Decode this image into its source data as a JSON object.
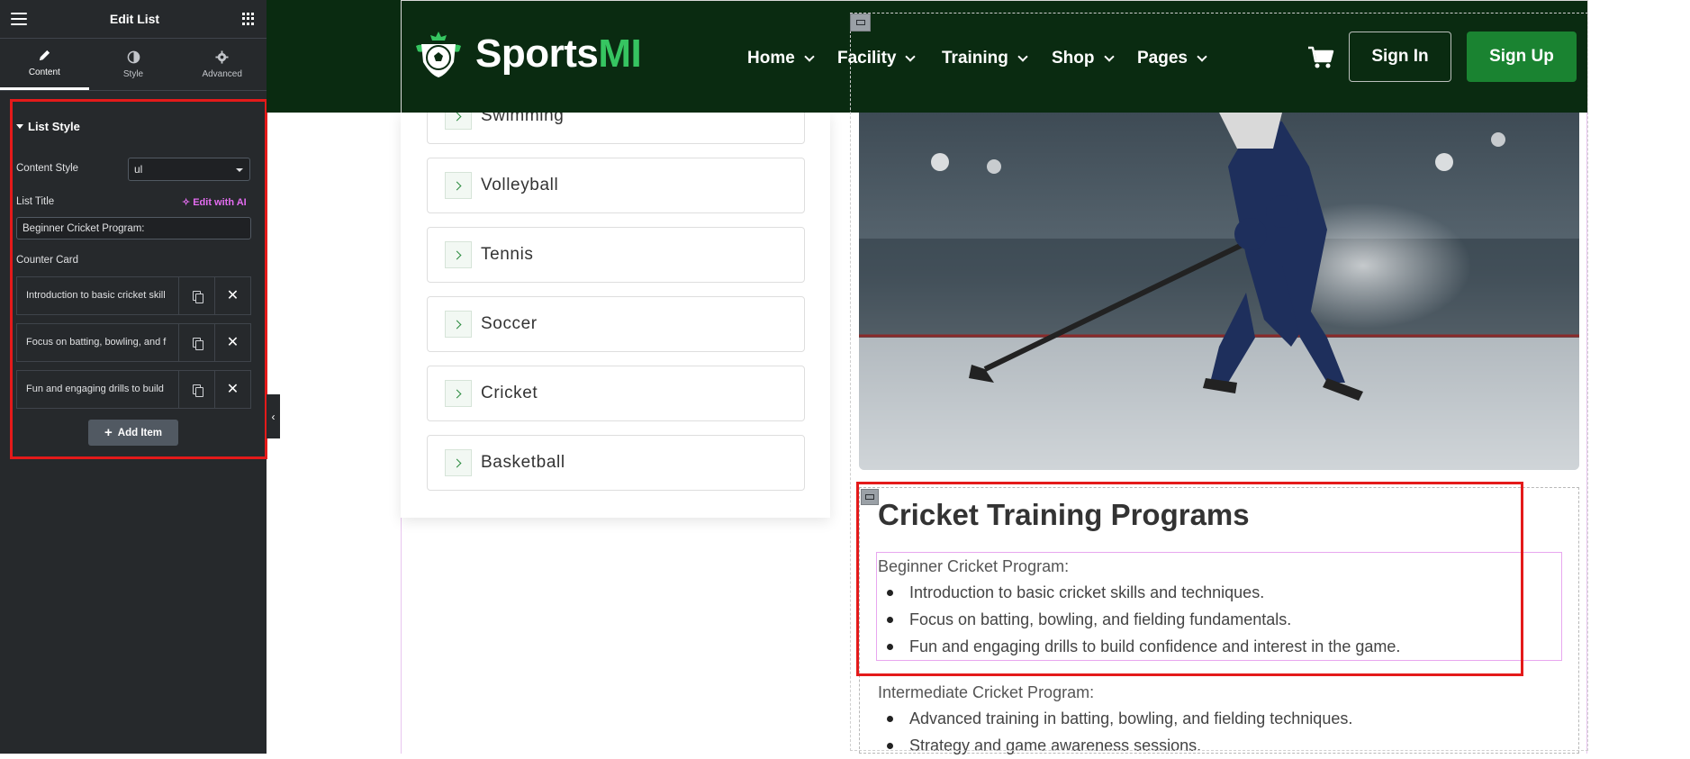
{
  "panel": {
    "title": "Edit List",
    "tabs": [
      {
        "label": "Content",
        "icon": "pencil-icon",
        "active": true
      },
      {
        "label": "Style",
        "icon": "half-circle-icon",
        "active": false
      },
      {
        "label": "Advanced",
        "icon": "gear-icon",
        "active": false
      }
    ],
    "section_title": "List Style",
    "content_style_label": "Content Style",
    "content_style_value": "ul",
    "list_title_label": "List Title",
    "edit_with_ai": "Edit with AI",
    "list_title_value": "Beginner Cricket Program:",
    "counter_card_label": "Counter Card",
    "items": [
      {
        "title": "Introduction to basic cricket skill"
      },
      {
        "title": "Focus on batting, bowling, and f"
      },
      {
        "title": "Fun and engaging drills to build"
      }
    ],
    "add_item": "Add Item"
  },
  "header": {
    "brand": "Sports",
    "brand_accent": "MI",
    "nav": [
      "Home",
      "Facility",
      "Training",
      "Shop",
      "Pages"
    ],
    "sign_in": "Sign In",
    "sign_up": "Sign Up",
    "colors": {
      "bg": "#0a2b11",
      "accent": "#36c561",
      "button": "#1a8331"
    }
  },
  "sports": [
    "Swimming",
    "Volleyball",
    "Tennis",
    "Soccer",
    "Cricket",
    "Basketball"
  ],
  "content": {
    "heading": "Cricket Training Programs",
    "beginner_title": "Beginner Cricket Program:",
    "beginner_items": [
      "Introduction to basic cricket skills and techniques.",
      "Focus on batting, bowling, and fielding fundamentals.",
      "Fun and engaging drills to build confidence and interest in the game."
    ],
    "intermediate_title": "Intermediate Cricket Program:",
    "intermediate_items": [
      "Advanced training in batting, bowling, and fielding techniques.",
      "Strategy and game awareness sessions."
    ]
  }
}
